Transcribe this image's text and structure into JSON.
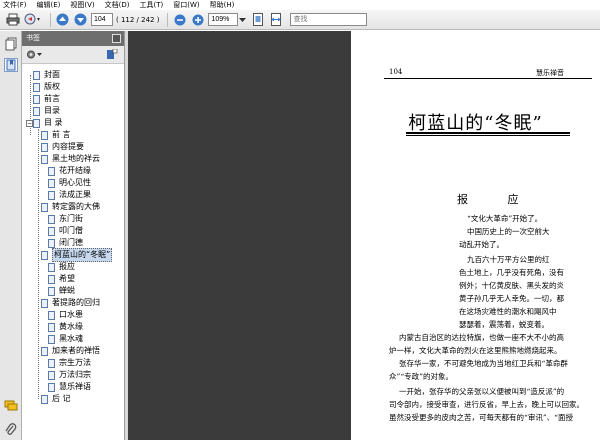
{
  "menu": [
    "文件(F)",
    "编辑(E)",
    "视图(V)",
    "文档(D)",
    "工具(T)",
    "窗口(W)",
    "帮助(H)"
  ],
  "toolbar": {
    "page_current": "104",
    "page_total": "( 112 / 242 )",
    "zoom": "109%",
    "find_placeholder": "查找"
  },
  "bookmarks": {
    "title": "书签",
    "items": [
      {
        "label": "封面"
      },
      {
        "label": "版权"
      },
      {
        "label": "前言"
      },
      {
        "label": "目录"
      },
      {
        "label": "目  录"
      },
      {
        "label": "前    言"
      },
      {
        "label": "内容提要"
      },
      {
        "label": "黑土地的祥云"
      },
      {
        "label": "花开结缘"
      },
      {
        "label": "明心见性"
      },
      {
        "label": "法成正果"
      },
      {
        "label": "转定露的大佛"
      },
      {
        "label": "东门街"
      },
      {
        "label": "叩门僧"
      },
      {
        "label": "闭门德"
      },
      {
        "label": "柯蓝山的“冬眠”"
      },
      {
        "label": "报应"
      },
      {
        "label": "希望"
      },
      {
        "label": "蝉蜕"
      },
      {
        "label": "著提路的回归"
      },
      {
        "label": "口水患"
      },
      {
        "label": "黄水缘"
      },
      {
        "label": "黑水魂"
      },
      {
        "label": "加来者的禅悟"
      },
      {
        "label": "宗生万法"
      },
      {
        "label": "万法归宗"
      },
      {
        "label": "慧乐禅语"
      },
      {
        "label": "后    记"
      }
    ]
  },
  "document": {
    "page_number": "104",
    "running_head": "慧乐禅音",
    "title": "柯蓝山的“冬眠”",
    "subtitle": "报    应",
    "lines": [
      "“文化大革命”开始了。",
      "中国历史上的一次空前大",
      "动乱开始了。",
      "九百六十万平方公里的红",
      "色土地上，几乎没有死角，没有",
      "例外；十亿黄皮肤、黑头发的炎",
      "黄子孙几乎无人幸免。一切，都",
      "在这场灾难性的潮水和飓风中",
      "瑟瑟着，震荡着，蜕变着。",
      "内蒙古自治区的达拉特旗，也做一座不大不小的高",
      "炉一样，文化大革命的烈火在这里熊熊地燃烧起来。",
      "张存华一家，不可避免地成为当地红卫兵和“革命群",
      "众”“专政”的对象。",
      "一开始，张存华的父亲张以义便被叫到“造反派”的",
      "司令部内，接受审查，进行反省，早上去，晚上可以回家。",
      "虽然没受更多的皮肉之苦，可每天都有的“审讯”、“面授"
    ]
  }
}
